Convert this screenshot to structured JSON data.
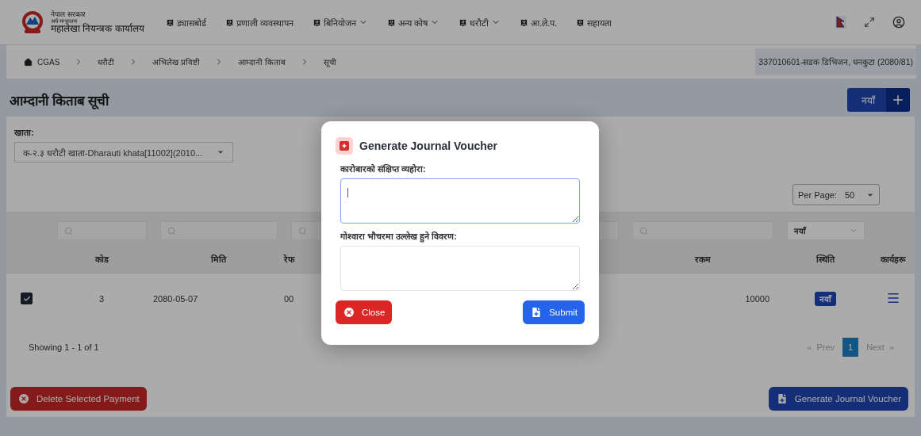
{
  "header": {
    "org_lines": [
      "नेपाल सरकार",
      "अर्थ मन्त्रालय",
      "महालेखा नियन्त्रक कार्यालय"
    ],
    "nav": [
      {
        "label": "ड्यासबोर्ड",
        "dropdown": false
      },
      {
        "label": "प्रणाली व्यवस्थापन",
        "dropdown": false
      },
      {
        "label": "बिनियोजन",
        "dropdown": true
      },
      {
        "label": "अन्य कोष",
        "dropdown": true
      },
      {
        "label": "धरौटी",
        "dropdown": true
      },
      {
        "label": "आ.ले.प.",
        "dropdown": false
      },
      {
        "label": "सहायता",
        "dropdown": false
      }
    ]
  },
  "breadcrumb": [
    "CGAS",
    "धरौटी",
    "अभिलेख प्रविष्टी",
    "आम्दानी किताब",
    "सूची"
  ],
  "office": "337010601-सडक डिभिजन, धनकुटा (2080/81)",
  "page_title": "आम्दानी किताब सूची",
  "new_button": "नयाँ",
  "account": {
    "label": "खाता:",
    "value": "क-२.३ धरौटी खाता-Dharauti khata[11002](2010..."
  },
  "per_page": {
    "label": "Per Page:",
    "value": "50"
  },
  "table": {
    "filters": [
      {
        "kind": "search"
      },
      {
        "kind": "search"
      },
      {
        "kind": "search"
      },
      {
        "kind": "search"
      },
      {
        "kind": "select",
        "value": "नयाँ"
      }
    ],
    "columns": [
      {
        "label": "कोड"
      },
      {
        "label": "मिति"
      },
      {
        "label": "रेफ"
      },
      {
        "label": "रकम"
      },
      {
        "label": "स्थिति"
      },
      {
        "label": "कार्यहरू"
      }
    ],
    "rows": [
      {
        "checked": true,
        "cells": [
          "3",
          "2080-05-07",
          "00",
          "10000"
        ],
        "status": "नयाँ"
      }
    ]
  },
  "showing": "Showing 1 - 1 of 1",
  "pagination": {
    "prev_icon": "«",
    "prev": "Prev",
    "pages": [
      {
        "label": "1",
        "selected": true
      }
    ],
    "next": "Next",
    "next_icon": "»",
    "prev_disabled": true,
    "next_disabled": true
  },
  "delete_button": "Delete Selected Payment",
  "generate_button": "Generate Journal Voucher",
  "modal": {
    "title": "Generate Journal Voucher",
    "fields": [
      {
        "label": "कारोबारको संक्षिप्त व्यहोरा:",
        "focused": true
      },
      {
        "label": "गोश्वारा भौचरमा उल्लेख हुने विवरण:",
        "focused": false
      }
    ],
    "close": "Close",
    "submit": "Submit"
  }
}
